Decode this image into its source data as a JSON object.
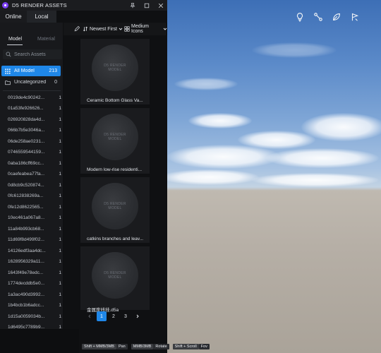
{
  "window": {
    "title": "D5 RENDER ASSETS"
  },
  "tabs": {
    "online": "Online",
    "local": "Local"
  },
  "sidebar": {
    "subtabs": {
      "model": "Model",
      "material": "Material"
    },
    "search_placeholder": "Search Assets",
    "categories": [
      {
        "label": "All Model",
        "count": "213"
      },
      {
        "label": "Uncategorized",
        "count": "0"
      }
    ],
    "items": [
      {
        "label": "0019de4c90242...",
        "count": "1"
      },
      {
        "label": "01a53fe926626...",
        "count": "1"
      },
      {
        "label": "026920828da4d...",
        "count": "1"
      },
      {
        "label": "066b7b5e3046a...",
        "count": "1"
      },
      {
        "label": "06de258ae0231...",
        "count": "1"
      },
      {
        "label": "0746559544159...",
        "count": "1"
      },
      {
        "label": "0aba186cff69cc...",
        "count": "1"
      },
      {
        "label": "0caefeabea77fa...",
        "count": "1"
      },
      {
        "label": "0d8cb9c520874...",
        "count": "1"
      },
      {
        "label": "0fc612838269a...",
        "count": "1"
      },
      {
        "label": "0fe12d8622565...",
        "count": "1"
      },
      {
        "label": "10ec461a067a8...",
        "count": "1"
      },
      {
        "label": "11a84b993cb68...",
        "count": "1"
      },
      {
        "label": "11d69f8d499f02...",
        "count": "1"
      },
      {
        "label": "14126edf3aa4dc...",
        "count": "1"
      },
      {
        "label": "1628956329a11...",
        "count": "1"
      },
      {
        "label": "1643f49e78edc...",
        "count": "1"
      },
      {
        "label": "1774decddb5e0...",
        "count": "1"
      },
      {
        "label": "1a3ac490d3992...",
        "count": "1"
      },
      {
        "label": "1b4bcb1b6adcc...",
        "count": "1"
      },
      {
        "label": "1d15a0059034b...",
        "count": "1"
      },
      {
        "label": "1d6495c7789b9...",
        "count": "1"
      }
    ]
  },
  "toolbar": {
    "sort_label": "Newest First",
    "view_label": "Medium Icons"
  },
  "grid": {
    "thumb_text_1": "D5 RENDER",
    "thumb_text_2": "MODEL",
    "cards": [
      {
        "label": "Ceramic Bottom Glass Va..."
      },
      {
        "label": "Modern low-rise residenti..."
      },
      {
        "label": "catkins branches and leav..."
      },
      {
        "label": "金属废线挂.d5a"
      }
    ]
  },
  "pagination": {
    "pages": [
      "1",
      "2",
      "3"
    ],
    "current": "1"
  },
  "statusbar": {
    "hints": [
      {
        "key": "Shift + MMB/3MB",
        "action": "Pan"
      },
      {
        "key": "MMB/3MB",
        "action": "Rotate"
      },
      {
        "key": "Shift + Scroll",
        "action": "Fov"
      }
    ]
  },
  "icons": {
    "viewport_tools": [
      "lightbulb-icon",
      "path-icon",
      "leaf-icon",
      "flag-icon"
    ]
  },
  "colors": {
    "accent": "#1f87e8",
    "panel_bg": "#151618",
    "logo": "#7b3ff2"
  }
}
